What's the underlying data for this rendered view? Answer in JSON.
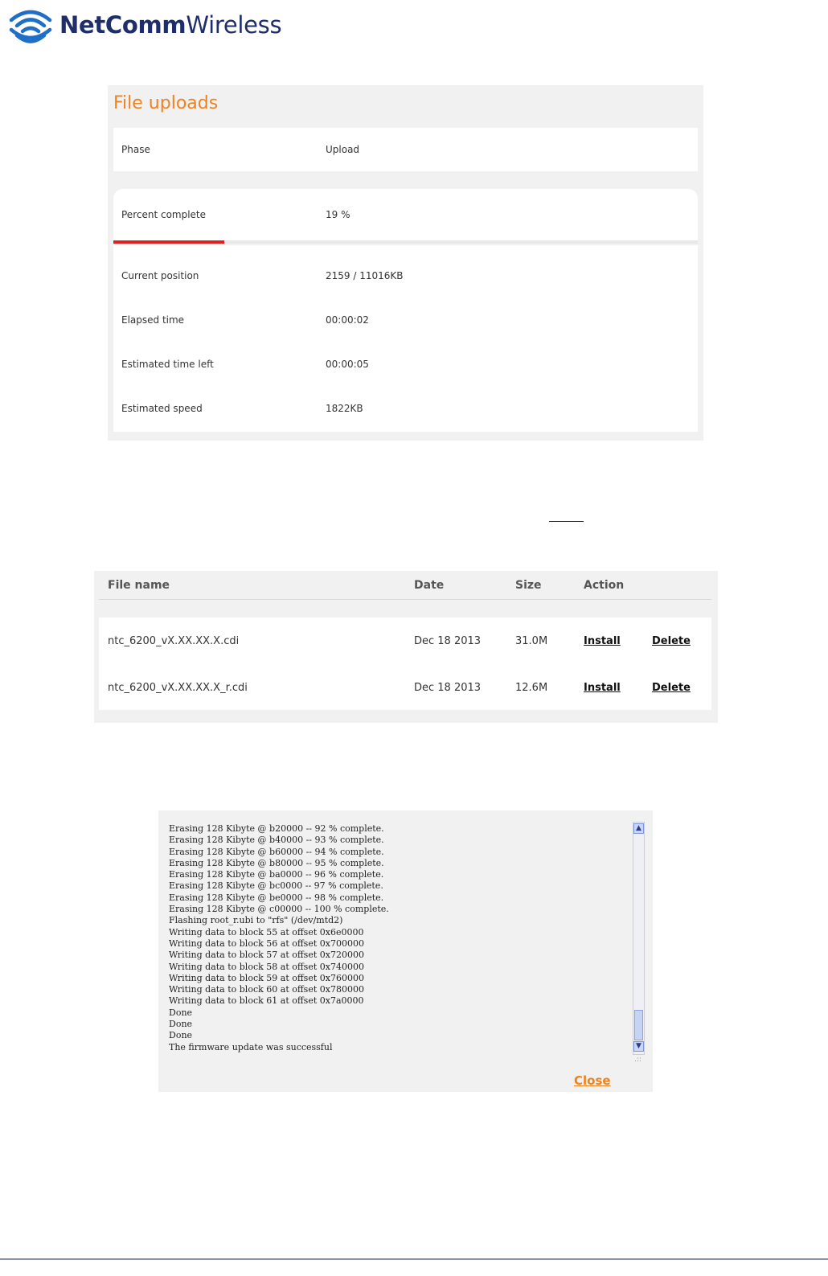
{
  "logo": {
    "brand_bold": "NetComm",
    "brand_light": "Wireless"
  },
  "upload": {
    "title": "File uploads",
    "phase": {
      "label": "Phase",
      "value": "Upload"
    },
    "percent": {
      "label": "Percent complete",
      "value": "19 %",
      "fraction": 0.19
    },
    "position": {
      "label": "Current position",
      "value": "2159 / 11016KB"
    },
    "elapsed": {
      "label": "Elapsed time",
      "value": "00:00:02"
    },
    "time_left": {
      "label": "Estimated time left",
      "value": "00:00:05"
    },
    "speed": {
      "label": "Estimated speed",
      "value": "1822KB"
    }
  },
  "files": {
    "headers": {
      "name": "File name",
      "date": "Date",
      "size": "Size",
      "action": "Action"
    },
    "rows": [
      {
        "name": "ntc_6200_vX.XX.XX.X.cdi",
        "date": "Dec 18 2013",
        "size": "31.0M",
        "install": "Install",
        "delete": "Delete"
      },
      {
        "name": "ntc_6200_vX.XX.XX.X_r.cdi",
        "date": "Dec 18 2013",
        "size": "12.6M",
        "install": "Install",
        "delete": "Delete"
      }
    ]
  },
  "log": {
    "lines": [
      "Erasing 128 Kibyte @ b20000 -- 92 % complete.",
      "Erasing 128 Kibyte @ b40000 -- 93 % complete.",
      "Erasing 128 Kibyte @ b60000 -- 94 % complete.",
      "Erasing 128 Kibyte @ b80000 -- 95 % complete.",
      "Erasing 128 Kibyte @ ba0000 -- 96 % complete.",
      "Erasing 128 Kibyte @ bc0000 -- 97 % complete.",
      "Erasing 128 Kibyte @ be0000 -- 98 % complete.",
      "Erasing 128 Kibyte @ c00000 -- 100 % complete.",
      "Flashing root_r.ubi to \"rfs\" (/dev/mtd2)",
      "Writing data to block 55 at offset 0x6e0000",
      "Writing data to block 56 at offset 0x700000",
      "Writing data to block 57 at offset 0x720000",
      "Writing data to block 58 at offset 0x740000",
      "Writing data to block 59 at offset 0x760000",
      "Writing data to block 60 at offset 0x780000",
      "Writing data to block 61 at offset 0x7a0000",
      "Done",
      "Done",
      "Done",
      "The firmware update was successful"
    ],
    "close_label": "Close"
  },
  "colors": {
    "accent": "#f0821e",
    "progress": "#e02020",
    "brand": "#1f2d6b"
  }
}
